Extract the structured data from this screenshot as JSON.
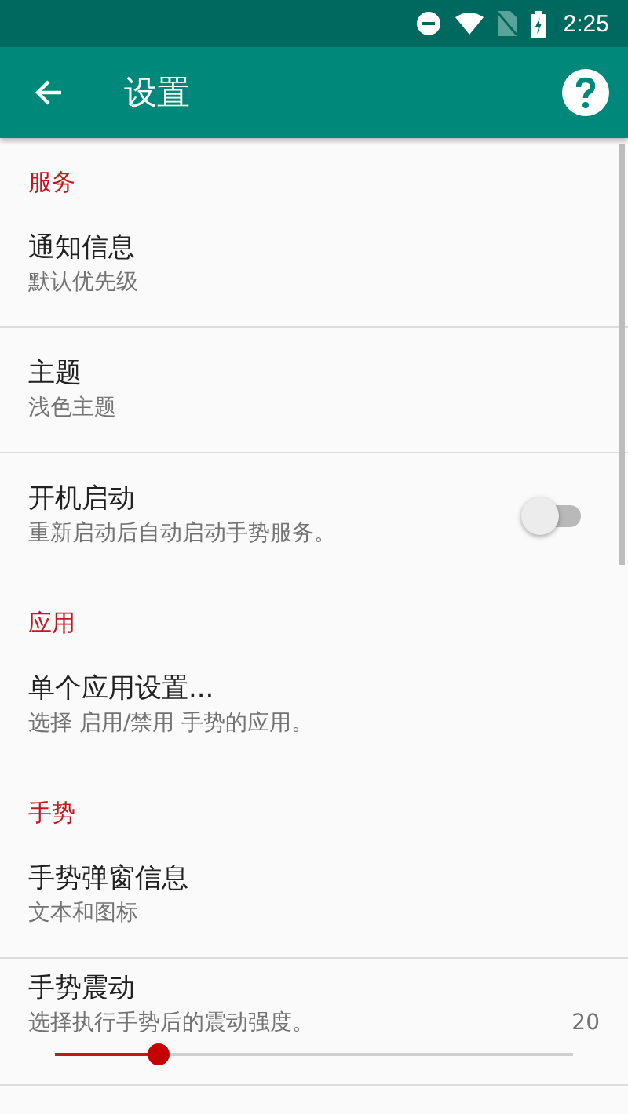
{
  "status_bar": {
    "time": "2:25"
  },
  "app_bar": {
    "title": "设置"
  },
  "sections": [
    {
      "header": "服务",
      "items": [
        {
          "kind": "text",
          "title": "通知信息",
          "subtitle": "默认优先级",
          "divider": true
        },
        {
          "kind": "text",
          "title": "主题",
          "subtitle": "浅色主题",
          "divider": true
        },
        {
          "kind": "switch",
          "title": "开机启动",
          "subtitle": "重新启动后自动启动手势服务。",
          "on": false,
          "divider": false
        }
      ]
    },
    {
      "header": "应用",
      "items": [
        {
          "kind": "text",
          "title": "单个应用设置...",
          "subtitle": "选择 启用/禁用 手势的应用。",
          "divider": false
        }
      ]
    },
    {
      "header": "手势",
      "items": [
        {
          "kind": "text",
          "title": "手势弹窗信息",
          "subtitle": "文本和图标",
          "divider": true
        },
        {
          "kind": "slider",
          "title": "手势震动",
          "subtitle": "选择执行手势后的震动强度。",
          "reading": "20",
          "level": 0.2,
          "divider": true
        }
      ]
    }
  ]
}
